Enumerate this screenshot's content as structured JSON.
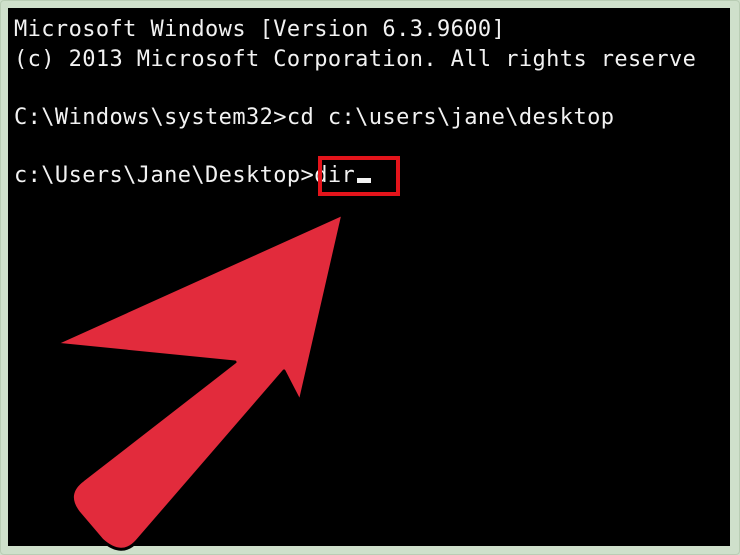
{
  "console": {
    "lines": {
      "version": "Microsoft Windows [Version 6.3.9600]",
      "copyright": "(c) 2013 Microsoft Corporation. All rights reserve",
      "command_line": "C:\\Windows\\system32>cd c:\\users\\jane\\desktop",
      "current_prompt": "c:\\Users\\Jane\\Desktop>",
      "typed_command": "dir"
    }
  },
  "colors": {
    "background": "#000000",
    "text": "#f2f2f2",
    "highlight": "#e4141b",
    "arrow": "#e22b3c",
    "frame": "#cfe0cb"
  },
  "icons": {
    "pointer": "red-arrow-icon"
  }
}
